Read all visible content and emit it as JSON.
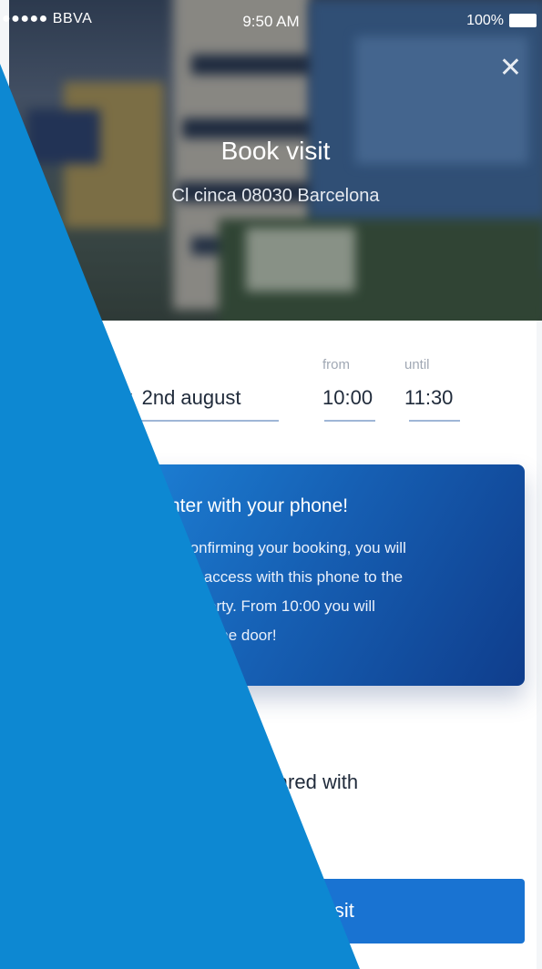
{
  "status_bar": {
    "carrier": "●●●●● BBVA",
    "time": "9:50 AM",
    "battery": "100%"
  },
  "header": {
    "title": "Book visit",
    "address": "Cl cinca 08030 Barcelona",
    "close_icon": "close-icon"
  },
  "form": {
    "date_value": "y, 2nd august",
    "from_label": "from",
    "from_value": "10:00",
    "until_label": "until",
    "until_value": "11:30"
  },
  "info_card": {
    "heading": "nter with your phone!",
    "body_lines": [
      "n confirming your booking, you will",
      "nted access with this phone to the",
      "' property. From 10:00 you will",
      "' open the door!"
    ]
  },
  "notice_text": "be shared with",
  "button": {
    "label": "isit"
  },
  "colors": {
    "accent_blue": "#1973d2",
    "overlay_blue": "#0d88d2",
    "card_start": "#1c7fd4",
    "card_end": "#0f3d8c"
  }
}
